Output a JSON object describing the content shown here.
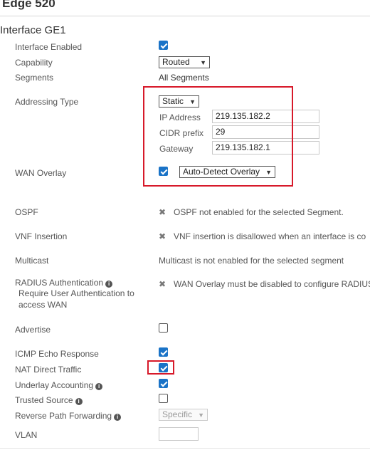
{
  "header": {
    "title": "Edge 520"
  },
  "section": {
    "title": "Interface GE1"
  },
  "fields": {
    "interface_enabled": {
      "label": "Interface Enabled",
      "checked": true
    },
    "capability": {
      "label": "Capability",
      "value": "Routed"
    },
    "segments": {
      "label": "Segments",
      "value": "All Segments"
    },
    "addressing_type": {
      "label": "Addressing Type",
      "value": "Static"
    },
    "ip_address": {
      "label": "IP Address",
      "value": "219.135.182.2"
    },
    "cidr_prefix": {
      "label": "CIDR prefix",
      "value": "29"
    },
    "gateway": {
      "label": "Gateway",
      "value": "219.135.182.1"
    },
    "wan_overlay": {
      "label": "WAN Overlay",
      "checked": true,
      "mode": "Auto-Detect Overlay"
    },
    "ospf": {
      "label": "OSPF",
      "message": "OSPF not enabled for the selected Segment."
    },
    "vnf_insertion": {
      "label": "VNF Insertion",
      "message": "VNF insertion is disallowed when an interface is co"
    },
    "multicast": {
      "label": "Multicast",
      "message": "Multicast is not enabled for the selected segment"
    },
    "radius": {
      "label": "RADIUS Authentication",
      "sub1": "Require User Authentication to",
      "sub2": "access WAN",
      "message": "WAN Overlay must be disabled to configure RADIUS"
    },
    "advertise": {
      "label": "Advertise",
      "checked": false
    },
    "icmp_echo": {
      "label": "ICMP Echo Response",
      "checked": true
    },
    "nat_direct": {
      "label": "NAT Direct Traffic",
      "checked": true
    },
    "underlay_accounting": {
      "label": "Underlay Accounting",
      "checked": true
    },
    "trusted_source": {
      "label": "Trusted Source",
      "checked": false
    },
    "rpf": {
      "label": "Reverse Path Forwarding",
      "value": "Specific"
    },
    "vlan": {
      "label": "VLAN",
      "value": ""
    }
  },
  "glyphs": {
    "x": "✖",
    "chevron": "▼",
    "info": "i"
  },
  "colors": {
    "highlight": "#d7192a",
    "checkbox": "#1a73c7"
  }
}
